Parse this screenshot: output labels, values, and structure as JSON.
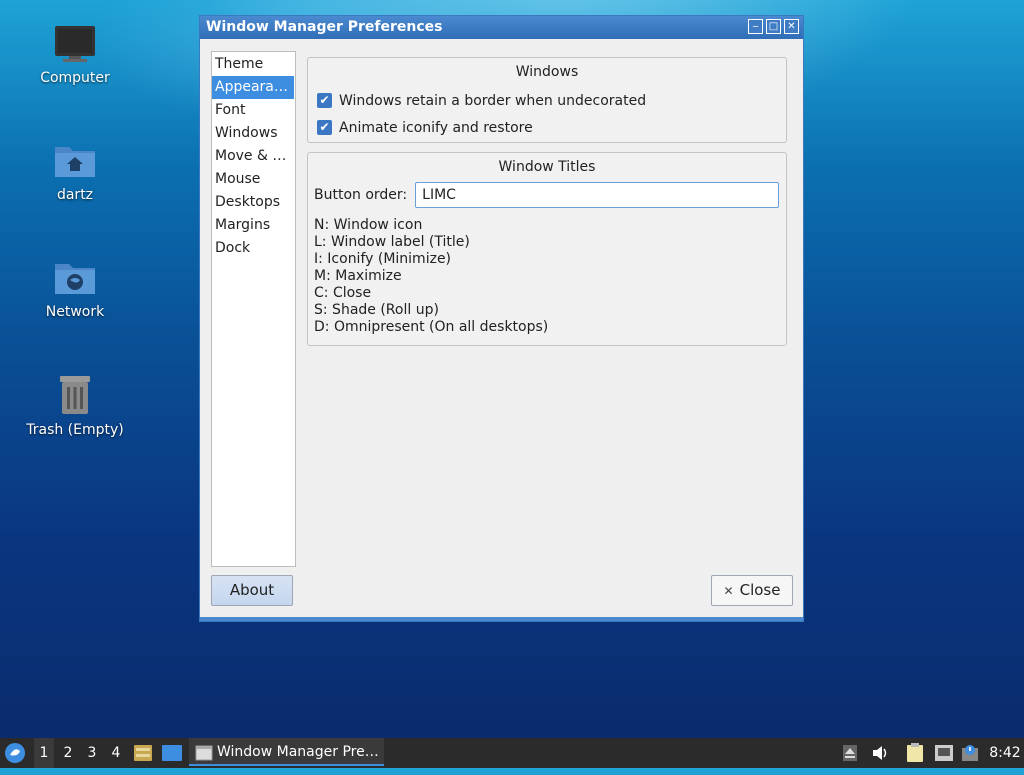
{
  "desktop": {
    "icons": [
      {
        "label": "Computer",
        "icon": "computer-icon"
      },
      {
        "label": "dartz",
        "icon": "home-folder-icon"
      },
      {
        "label": "Network",
        "icon": "network-folder-icon"
      },
      {
        "label": "Trash (Empty)",
        "icon": "trash-icon"
      }
    ]
  },
  "window": {
    "title": "Window Manager Preferences",
    "controls": {
      "minimize": "‒",
      "maximize": "□",
      "close": "✕"
    },
    "sidebar": {
      "items": [
        "Theme",
        "Appeara…",
        "Font",
        "Windows",
        "Move & …",
        "Mouse",
        "Desktops",
        "Margins",
        "Dock"
      ],
      "selected": "Appeara…"
    },
    "windows_section": {
      "title": "Windows",
      "options": [
        {
          "label": "Windows retain a border when undecorated",
          "checked": true
        },
        {
          "label": "Animate iconify and restore",
          "checked": true
        }
      ]
    },
    "titles_section": {
      "title": "Window Titles",
      "button_order_label": "Button order:",
      "button_order_value": "LIMC",
      "legend": [
        "N: Window icon",
        "L: Window label (Title)",
        "I: Iconify (Minimize)",
        "M: Maximize",
        "C: Close",
        "S: Shade (Roll up)",
        "D: Omnipresent (On all desktops)"
      ]
    },
    "about_label": "About",
    "close_label": "Close",
    "close_icon": "✕"
  },
  "taskbar": {
    "workspaces": [
      "1",
      "2",
      "3",
      "4"
    ],
    "active_workspace": "1",
    "task_label": "Window Manager Pre…",
    "clock": "8:42"
  },
  "colors": {
    "accent": "#3d8ee0",
    "titlebar": "#3a78bf",
    "taskbar": "#2b2b2b"
  }
}
